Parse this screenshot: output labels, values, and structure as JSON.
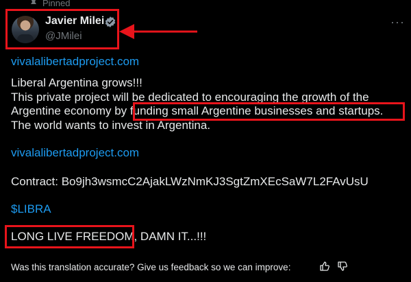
{
  "post": {
    "pinned_label": "Pinned",
    "author_name": "Javier Milei",
    "author_handle": "@JMilei",
    "more_label": "···",
    "link_top": "vivalalibertadproject.com",
    "line1": "Liberal Argentina grows!!!",
    "line2": "This private project will be dedicated to encouraging the growth of the",
    "line3_prefix": "Argentine economy by ",
    "line3_highlight": "funding small Argentine businesses and startups.",
    "line4": "The world wants to invest in Argentina.",
    "link_middle": "vivalalibertadproject.com",
    "contract": "Contract: Bo9jh3wsmcC2AjakLWzNmKJ3SgtZmXEcSaW7L2FAvUsU",
    "cashtag": "$LIBRA",
    "closing_highlight": "LONG LIVE FREEDOM,",
    "closing_rest": " DAMN IT...!!!",
    "translation_feedback": "Was this translation accurate? Give us feedback so we can improve:"
  },
  "icons": {
    "pin": "pin-icon",
    "verified": "verified-badge-icon",
    "thumb_up": "thumbs-up-icon",
    "thumb_down": "thumbs-down-icon"
  },
  "colors": {
    "background": "#000000",
    "text": "#e7e9ea",
    "muted": "#71767b",
    "link": "#1d9bf0",
    "annotation_red": "#e8141b"
  }
}
